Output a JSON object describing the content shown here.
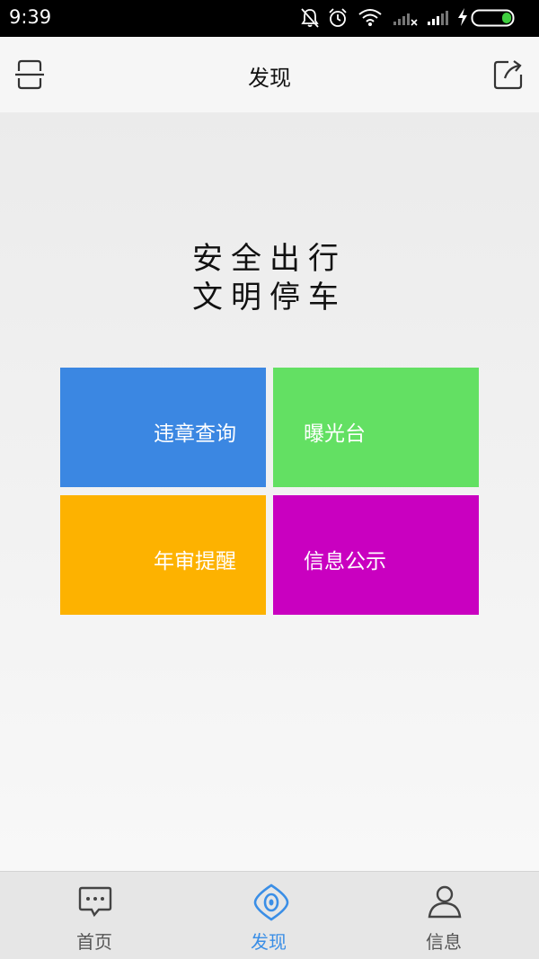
{
  "status_bar": {
    "time": "9:39",
    "icons": [
      "bell-muted-icon",
      "alarm-icon",
      "wifi-icon",
      "signal-icon",
      "signal-icon",
      "charging-icon",
      "battery-icon"
    ],
    "battery_color": "#3fce3f"
  },
  "header": {
    "title": "发现",
    "left_icon": "scan-icon",
    "right_icon": "share-icon"
  },
  "slogan": {
    "line1": "安全出行",
    "line2": "文明停车"
  },
  "tiles": [
    {
      "label": "违章查询",
      "color": "#3b87e2"
    },
    {
      "label": "曝光台",
      "color": "#63e063"
    },
    {
      "label": "年审提醒",
      "color": "#fdb200"
    },
    {
      "label": "信息公示",
      "color": "#c900c0"
    }
  ],
  "tabbar": {
    "items": [
      {
        "label": "首页",
        "icon": "chat-bubble-icon",
        "active": false
      },
      {
        "label": "发现",
        "icon": "eye-icon",
        "active": true
      },
      {
        "label": "信息",
        "icon": "person-icon",
        "active": false
      }
    ],
    "active_color": "#3a8ee6",
    "inactive_color": "#555555"
  }
}
